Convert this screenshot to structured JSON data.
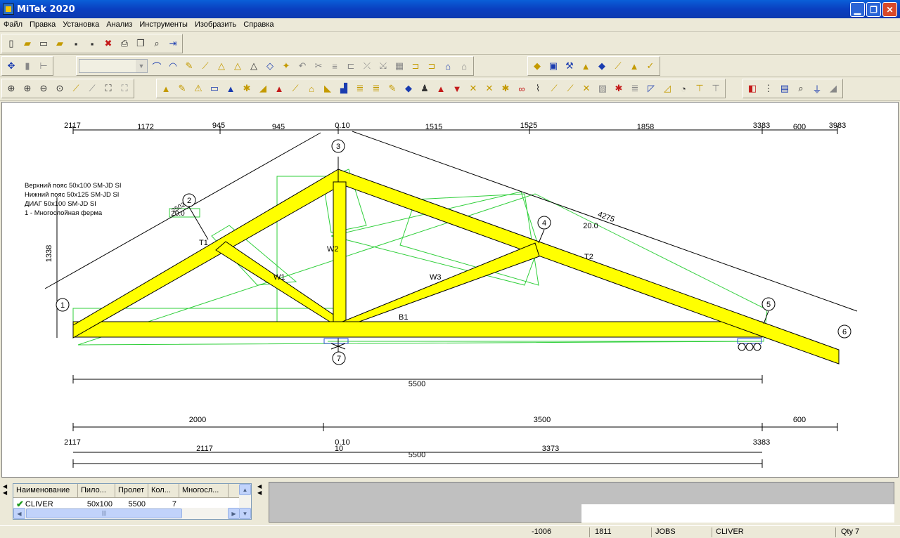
{
  "window": {
    "title": "MiTek 2020",
    "minimize": "▁",
    "maximize": "❐",
    "close": "✕"
  },
  "menu": [
    "Файл",
    "Правка",
    "Установка",
    "Анализ",
    "Инструменты",
    "Изобразить",
    "Справка"
  ],
  "toolbar": {
    "combo_value": ""
  },
  "drawing": {
    "legend": [
      "Верхний пояс 50x100 SM-JD SI",
      "Нижний пояс 50x125 SM-JD SI",
      "ДИАГ 50x100 SM-JD SI",
      "1 - Многослойная ферма"
    ],
    "top_dims": [
      "2117",
      "1172",
      "945",
      "945",
      "0.10",
      "1515",
      "1525",
      "1858",
      "3383",
      "600",
      "3983"
    ],
    "height_dim": "1338",
    "slope_dim": "4275",
    "angle": "20.0",
    "angle_left": "20.0",
    "slope_left": "2502",
    "nodes": [
      "1",
      "2",
      "3",
      "4",
      "5",
      "6",
      "7"
    ],
    "members": [
      "T1",
      "T2",
      "W1",
      "W2",
      "W3",
      "B1"
    ],
    "span": "5500",
    "bottom_dims_1": [
      "2000",
      "3500",
      "600"
    ],
    "bottom_dims_2": [
      "2117",
      "0.10",
      "3383"
    ],
    "bottom_dims_3": [
      "2117",
      "10",
      "3373"
    ],
    "span_total": "5500"
  },
  "grid": {
    "headers": [
      "Наименование",
      "Пило...",
      "Пролет",
      "Кол...",
      "Многосл..."
    ],
    "row": {
      "name": "CLIVER",
      "lumber": "50x100",
      "span": "5500",
      "qty": "7",
      "ply": ""
    }
  },
  "status": {
    "x": "-1006",
    "y": "1811",
    "mode": "JOBS",
    "job": "CLIVER",
    "qty": "Qty 7"
  }
}
